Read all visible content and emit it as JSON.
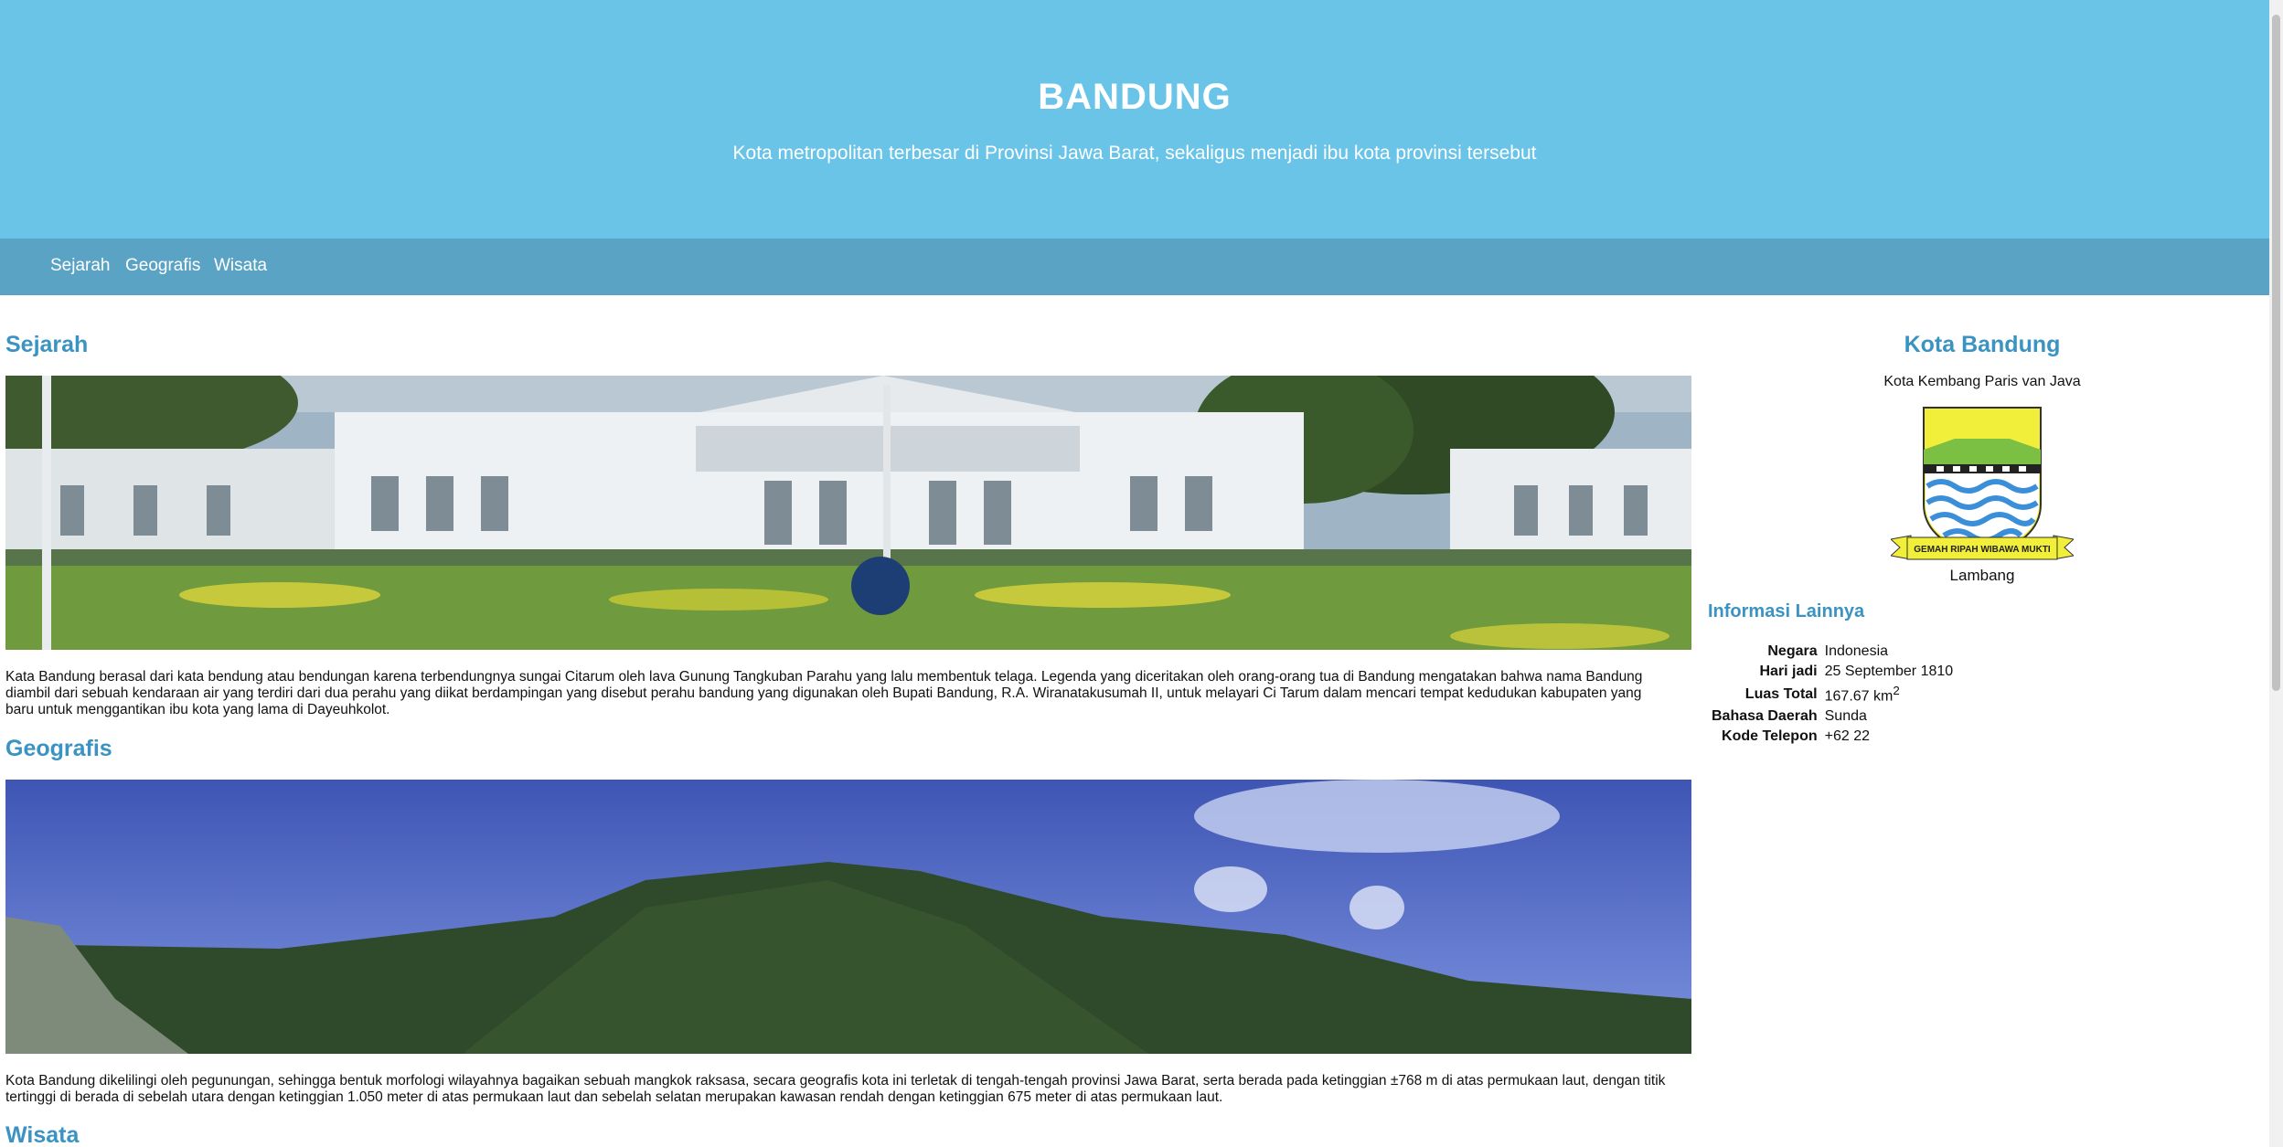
{
  "header": {
    "title": "BANDUNG",
    "subtitle": "Kota metropolitan terbesar di Provinsi Jawa Barat, sekaligus menjadi ibu kota provinsi tersebut"
  },
  "nav": [
    {
      "label": "Sejarah"
    },
    {
      "label": "Geografis"
    },
    {
      "label": "Wisata"
    }
  ],
  "sections": {
    "sejarah": {
      "title": "Sejarah",
      "text": "Kata Bandung berasal dari kata bendung atau bendungan karena terbendungnya sungai Citarum oleh lava Gunung Tangkuban Parahu yang lalu membentuk telaga. Legenda yang diceritakan oleh orang-orang tua di Bandung mengatakan bahwa nama Bandung diambil dari sebuah kendaraan air yang terdiri dari dua perahu yang diikat berdampingan yang disebut perahu bandung yang digunakan oleh Bupati Bandung, R.A. Wiranatakusumah II, untuk melayari Ci Tarum dalam mencari tempat kedudukan kabupaten yang baru untuk menggantikan ibu kota yang lama di Dayeuhkolot."
    },
    "geografis": {
      "title": "Geografis",
      "text": "Kota Bandung dikelilingi oleh pegunungan, sehingga bentuk morfologi wilayahnya bagaikan sebuah mangkok raksasa, secara geografis kota ini terletak di tengah-tengah provinsi Jawa Barat, serta berada pada ketinggian ±768 m di atas permukaan laut, dengan titik tertinggi di berada di sebelah utara dengan ketinggian 1.050 meter di atas permukaan laut dan sebelah selatan merupakan kawasan rendah dengan ketinggian 675 meter di atas permukaan laut."
    },
    "wisata": {
      "title": "Wisata"
    }
  },
  "sidebar": {
    "title": "Kota Bandung",
    "subtitle": "Kota Kembang Paris van Java",
    "emblem_motto": "GEMAH RIPAH WIBAWA MUKTI",
    "emblem_caption": "Lambang",
    "info_title": "Informasi Lainnya",
    "info": [
      {
        "key": "Negara",
        "value": "Indonesia"
      },
      {
        "key": "Hari jadi",
        "value": "25 September 1810"
      },
      {
        "key": "Luas Total",
        "value": "167.67 km",
        "sup": "2"
      },
      {
        "key": "Bahasa Daerah",
        "value": "Sunda"
      },
      {
        "key": "Kode Telepon",
        "value": "+62 22"
      }
    ]
  },
  "colors": {
    "header_bg": "#6ac4e8",
    "nav_bg": "#5aa3c5",
    "heading": "#3a93c2"
  }
}
